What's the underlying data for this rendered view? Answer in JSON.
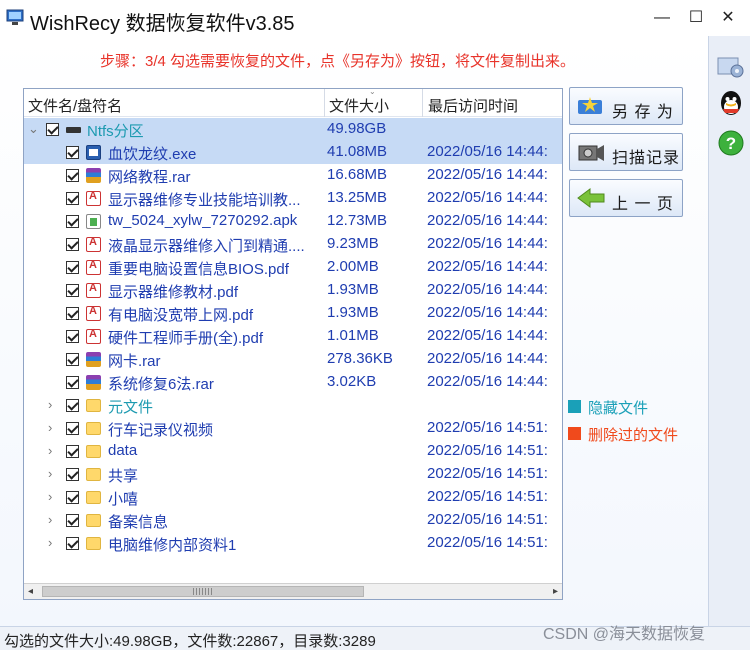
{
  "window": {
    "title": "WishRecy 数据恢复软件v3.85",
    "minimize": "—",
    "maximize": "☐",
    "close": "✕"
  },
  "step_instruction": "步骤：3/4 勾选需要恢复的文件，点《另存为》按钮，将文件复制出来。",
  "columns": {
    "name": "文件名/盘符名",
    "size": "文件大小",
    "date": "最后访问时间"
  },
  "drive": {
    "name": "Ntfs分区",
    "size": "49.98GB",
    "expander": "⌄"
  },
  "files": [
    {
      "name": "血饮龙纹.exe",
      "size": "41.08MB",
      "date": "2022/05/16 14:44:",
      "icon": "exe-icon",
      "selected": true
    },
    {
      "name": "网络教程.rar",
      "size": "16.68MB",
      "date": "2022/05/16 14:44:",
      "icon": "rar-icon"
    },
    {
      "name": "显示器维修专业技能培训教...",
      "size": "13.25MB",
      "date": "2022/05/16 14:44:",
      "icon": "pdf-icon"
    },
    {
      "name": "tw_5024_xylw_7270292.apk",
      "size": "12.73MB",
      "date": "2022/05/16 14:44:",
      "icon": "apk-icon"
    },
    {
      "name": "液晶显示器维修入门到精通....",
      "size": "9.23MB",
      "date": "2022/05/16 14:44:",
      "icon": "pdf-icon"
    },
    {
      "name": "重要电脑设置信息BIOS.pdf",
      "size": "2.00MB",
      "date": "2022/05/16 14:44:",
      "icon": "pdf-icon"
    },
    {
      "name": "显示器维修教材.pdf",
      "size": "1.93MB",
      "date": "2022/05/16 14:44:",
      "icon": "pdf-icon"
    },
    {
      "name": "有电脑没宽带上网.pdf",
      "size": "1.93MB",
      "date": "2022/05/16 14:44:",
      "icon": "pdf-icon"
    },
    {
      "name": "硬件工程师手册(全).pdf",
      "size": "1.01MB",
      "date": "2022/05/16 14:44:",
      "icon": "pdf-icon"
    },
    {
      "name": "网卡.rar",
      "size": "278.36KB",
      "date": "2022/05/16 14:44:",
      "icon": "rar-icon"
    },
    {
      "name": "系统修复6法.rar",
      "size": "3.02KB",
      "date": "2022/05/16 14:44:",
      "icon": "rar-icon"
    }
  ],
  "folders": [
    {
      "name": "元文件",
      "date": "",
      "hidden": true
    },
    {
      "name": "行车记录仪视频",
      "date": "2022/05/16 14:51:"
    },
    {
      "name": "data",
      "date": "2022/05/16 14:51:"
    },
    {
      "name": "共享",
      "date": "2022/05/16 14:51:"
    },
    {
      "name": "小嘻",
      "date": "2022/05/16 14:51:"
    },
    {
      "name": "备案信息",
      "date": "2022/05/16 14:51:"
    },
    {
      "name": "电脑维修内部资料1",
      "date": "2022/05/16 14:51:"
    }
  ],
  "folder_expander": "›",
  "scroll": {
    "left": "◂",
    "right": "▸"
  },
  "buttons": {
    "save_as": "另 存 为",
    "scan_record": "扫描记录",
    "prev_page": "上 一 页"
  },
  "legend": {
    "hidden": {
      "label": "隐藏文件",
      "color": "#1aa0b8"
    },
    "deleted": {
      "label": "删除过的文件",
      "color": "#f04a1c"
    }
  },
  "status": "勾选的文件大小:49.98GB，文件数:22867，目录数:3289",
  "watermark": "CSDN @海天数据恢复"
}
